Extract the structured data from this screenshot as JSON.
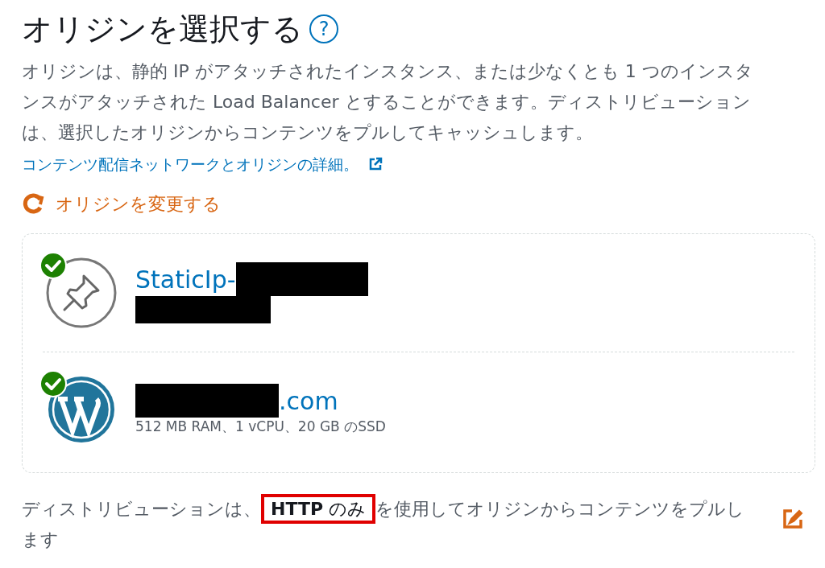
{
  "header": {
    "title": "オリジンを選択する",
    "help": "?"
  },
  "description": "オリジンは、静的 IP がアタッチされたインスタンス、または少なくとも 1 つのインスタンスがアタッチされた Load Balancer とすることができます。ディストリビューションは、選択したオリジンからコンテンツをプルしてキャッシュします。",
  "learn_more_link": "コンテンツ配信ネットワークとオリジンの詳細。",
  "change_origin": "オリジンを変更する",
  "origins": [
    {
      "kind": "static_ip",
      "name": "StaticIp-",
      "redacted_after_name": true,
      "redacted_before_name": false,
      "redacted_detail": true,
      "verified": true
    },
    {
      "kind": "wordpress",
      "name": ".com",
      "redacted_after_name": false,
      "redacted_before_name": true,
      "details": "512 MB RAM、1 vCPU、20 GB のSSD",
      "verified": true
    }
  ],
  "protocol_note": {
    "before": "ディストリビューションは、",
    "highlighted": "**HTTP** のみ",
    "after": "を使用してオリジンからコンテンツをプルします"
  }
}
